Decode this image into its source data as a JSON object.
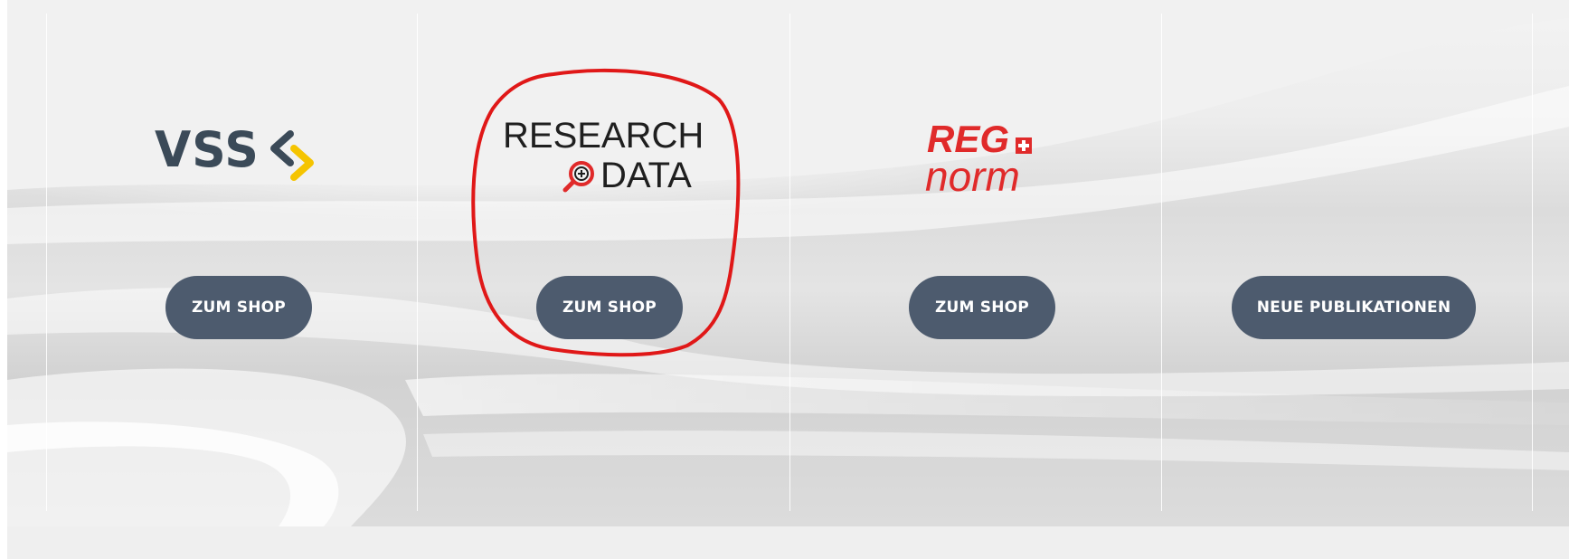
{
  "columns": [
    {
      "logo": {
        "type": "vss",
        "text": "VSS",
        "icon": "chevron-arrows-icon",
        "text_color": "#3b4a58",
        "accent_color": "#f5c400"
      },
      "button_label": "ZUM SHOP"
    },
    {
      "logo": {
        "type": "research-data",
        "line1": "RESEARCH",
        "line2": "DATA",
        "icon": "magnifier-plus-icon",
        "text_color": "#1f1f1f",
        "accent_color": "#e02a2a"
      },
      "button_label": "ZUM SHOP",
      "highlighted": true
    },
    {
      "logo": {
        "type": "regnorm",
        "line1": "REG",
        "line2": "norm",
        "icon": "swiss-cross-icon",
        "color": "#e02a2a"
      },
      "button_label": "ZUM SHOP"
    },
    {
      "logo": null,
      "button_label": "NEUE PUBLIKATIONEN"
    }
  ],
  "colors": {
    "button_bg": "#4d5b6e",
    "button_text": "#ffffff",
    "annotation": "#e01818"
  }
}
